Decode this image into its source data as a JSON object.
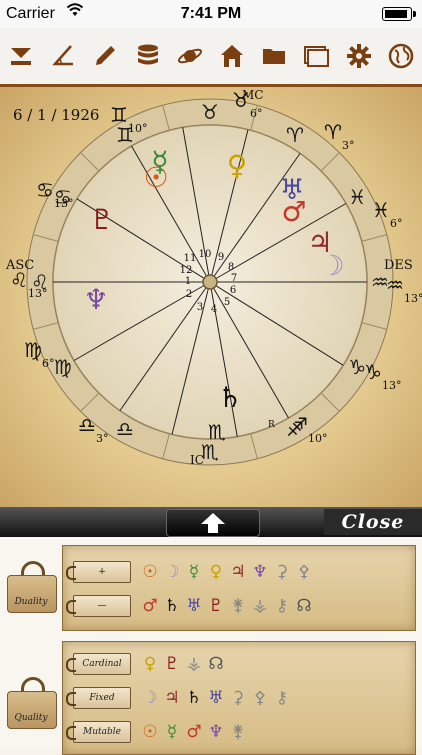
{
  "status": {
    "carrier": "Carrier",
    "time": "7:41 PM",
    "battery_level": 0.9
  },
  "toolbar": {
    "icons": [
      "download-icon",
      "angle-icon",
      "pencil-icon",
      "database-icon",
      "planet-icon",
      "house-icon",
      "folder-icon",
      "window-icon",
      "gear-icon",
      "globe-icon"
    ]
  },
  "chart": {
    "date": "6 / 1 / 1926",
    "asc_label": "ASC",
    "des_label": "DES",
    "mc_label": "MC",
    "ic_label": "IC",
    "retro_label": "R",
    "house_numbers": [
      "1",
      "2",
      "3",
      "4",
      "5",
      "6",
      "7",
      "8",
      "9",
      "10",
      "11",
      "12"
    ],
    "ring_signs": [
      {
        "sym": "♉",
        "color": "#1a1a1a"
      },
      {
        "sym": "♈",
        "color": "#1a1a1a"
      },
      {
        "sym": "♓",
        "color": "#1a1a1a"
      },
      {
        "sym": "♒",
        "color": "#1a1a1a"
      },
      {
        "sym": "♑",
        "color": "#1a1a1a"
      },
      {
        "sym": "♐",
        "color": "#1a1a1a"
      },
      {
        "sym": "♏",
        "color": "#1a1a1a"
      },
      {
        "sym": "♎",
        "color": "#1a1a1a"
      },
      {
        "sym": "♍",
        "color": "#1a1a1a"
      },
      {
        "sym": "♌",
        "color": "#1a1a1a"
      },
      {
        "sym": "♋",
        "color": "#1a1a1a"
      },
      {
        "sym": "♊",
        "color": "#1a1a1a"
      }
    ],
    "cusps": [
      {
        "sym": "♉",
        "deg": "6°"
      },
      {
        "sym": "♈",
        "deg": "3°"
      },
      {
        "sym": "♓",
        "deg": "6°"
      },
      {
        "sym": "♒",
        "deg": "13°"
      },
      {
        "sym": "♑",
        "deg": "13°"
      },
      {
        "sym": "♐",
        "deg": "10°"
      },
      {
        "sym": "♏",
        "deg": ""
      },
      {
        "sym": "♎",
        "deg": "3°"
      },
      {
        "sym": "♍",
        "deg": "6°"
      },
      {
        "sym": "♌",
        "deg": "13°"
      },
      {
        "sym": "♋",
        "deg": "13°"
      },
      {
        "sym": "♊",
        "deg": "10°"
      }
    ],
    "planets": [
      {
        "sym": "☉",
        "color": "#d35b1a"
      },
      {
        "sym": "☿",
        "color": "#3b8a3b"
      },
      {
        "sym": "♀",
        "color": "#c8a200"
      },
      {
        "sym": "♅",
        "color": "#4a4aa0"
      },
      {
        "sym": "♂",
        "color": "#c0392b"
      },
      {
        "sym": "♃",
        "color": "#8e2a2a"
      },
      {
        "sym": "☽",
        "color": "#9a8fc8"
      },
      {
        "sym": "♄",
        "color": "#111111"
      },
      {
        "sym": "♇",
        "color": "#8b1a1a"
      },
      {
        "sym": "♆",
        "color": "#7a4aa0"
      }
    ]
  },
  "drawer": {
    "close_label": "Close"
  },
  "duality": {
    "label": "Duality",
    "rows": [
      {
        "label": "+",
        "glyphs": [
          {
            "s": "☉",
            "c": "#d35b1a"
          },
          {
            "s": "☽",
            "c": "#9a8fc8"
          },
          {
            "s": "☿",
            "c": "#3b8a3b"
          },
          {
            "s": "♀",
            "c": "#c8a200"
          },
          {
            "s": "♃",
            "c": "#8e2a2a"
          },
          {
            "s": "♆",
            "c": "#7a4aa0"
          },
          {
            "s": "⚳",
            "c": "#888888"
          },
          {
            "s": "⚴",
            "c": "#888888"
          }
        ]
      },
      {
        "label": "—",
        "glyphs": [
          {
            "s": "♂",
            "c": "#c0392b"
          },
          {
            "s": "♄",
            "c": "#111111"
          },
          {
            "s": "♅",
            "c": "#4a4aa0"
          },
          {
            "s": "♇",
            "c": "#8b1a1a"
          },
          {
            "s": "⚵",
            "c": "#888888"
          },
          {
            "s": "⚶",
            "c": "#888888"
          },
          {
            "s": "⚷",
            "c": "#888888"
          },
          {
            "s": "☊",
            "c": "#555555"
          }
        ]
      }
    ]
  },
  "quality": {
    "label": "Quality",
    "rows": [
      {
        "label": "Cardinal",
        "glyphs": [
          {
            "s": "♀",
            "c": "#c8a200"
          },
          {
            "s": "♇",
            "c": "#8b1a1a"
          },
          {
            "s": "⚶",
            "c": "#888888"
          },
          {
            "s": "☊",
            "c": "#555555"
          }
        ]
      },
      {
        "label": "Fixed",
        "glyphs": [
          {
            "s": "☽",
            "c": "#9a8fc8"
          },
          {
            "s": "♃",
            "c": "#8e2a2a"
          },
          {
            "s": "♄",
            "c": "#111111"
          },
          {
            "s": "♅",
            "c": "#4a4aa0"
          },
          {
            "s": "⚳",
            "c": "#888888"
          },
          {
            "s": "⚴",
            "c": "#888888"
          },
          {
            "s": "⚷",
            "c": "#888888"
          }
        ]
      },
      {
        "label": "Mutable",
        "glyphs": [
          {
            "s": "☉",
            "c": "#d35b1a"
          },
          {
            "s": "☿",
            "c": "#3b8a3b"
          },
          {
            "s": "♂",
            "c": "#c0392b"
          },
          {
            "s": "♆",
            "c": "#7a4aa0"
          },
          {
            "s": "⚵",
            "c": "#888888"
          }
        ]
      }
    ]
  },
  "accent": "#8a4a14"
}
